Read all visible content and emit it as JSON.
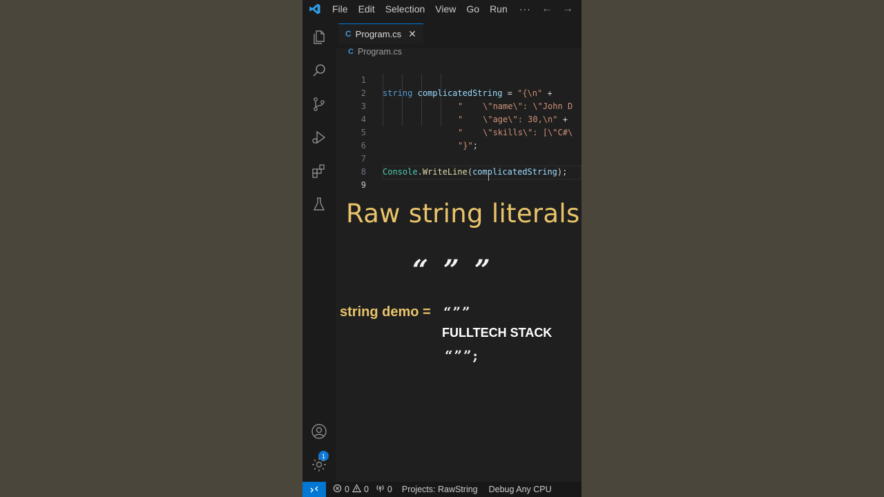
{
  "menu": {
    "items": [
      "File",
      "Edit",
      "Selection",
      "View",
      "Go",
      "Run"
    ],
    "more": "···",
    "back": "←",
    "forward": "→"
  },
  "activity": {
    "icons": [
      "explorer-icon",
      "search-icon",
      "source-control-icon",
      "run-debug-icon",
      "extensions-icon",
      "testing-icon",
      "accounts-icon",
      "manage-gear-icon"
    ],
    "accounts_badge": "1"
  },
  "tab": {
    "label": "Program.cs",
    "close": "✕",
    "glyph": "C"
  },
  "breadcrumb": {
    "file": "Program.cs",
    "glyph": "C"
  },
  "editor": {
    "line_numbers": [
      "1",
      "2",
      "3",
      "4",
      "5",
      "6",
      "7",
      "8",
      "9"
    ],
    "line1": {
      "kw": "string",
      "var": "complicatedString",
      "op": " = ",
      "str": "\"{\\n\"",
      "plus": " +"
    },
    "line2": {
      "str": "\"    \\\"name\\\": \\\"John D"
    },
    "line3": {
      "str": "\"    \\\"age\\\": 30,\\n\"",
      "plus": " +"
    },
    "line4": {
      "str": "\"    \\\"skills\\\": [\\\"C#\\"
    },
    "line5": {
      "str": "\"}\"",
      "semi": ";"
    },
    "line7": {
      "cls": "Console",
      "dot": ".",
      "fn": "WriteLine",
      "open": "(",
      "var": "complicatedString",
      "close": ");"
    }
  },
  "overlay": {
    "title": "Raw string literals",
    "quotes": "“ ” ”",
    "demo_label": "string demo =",
    "quotes_open": "“””",
    "demo_value": "FULLTECH STACK",
    "quotes_close": "“””;"
  },
  "status": {
    "errors": "0",
    "warnings": "0",
    "ports": "0",
    "projects": "Projects: RawString",
    "config": "Debug Any CPU"
  },
  "colors": {
    "accent": "#0078d4",
    "title_yellow": "#e9c46a",
    "editor_bg": "#1f1f1f"
  }
}
